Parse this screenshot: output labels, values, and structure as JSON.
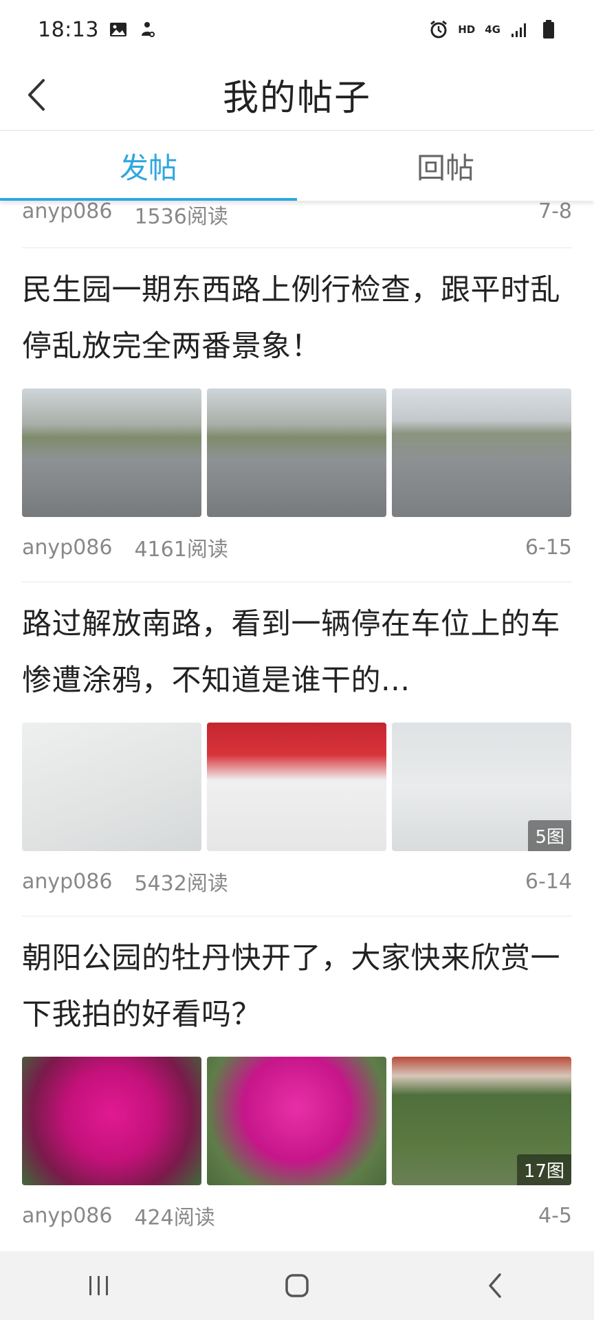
{
  "status_bar": {
    "time": "18:13",
    "left_icons": [
      "image-icon",
      "notification-icon"
    ],
    "right_icons": [
      "alarm-icon",
      "hd-icon",
      "4g-icon",
      "signal-icon",
      "battery-icon"
    ],
    "hd_label": "HD",
    "network_label": "4G"
  },
  "header": {
    "title": "我的帖子",
    "back_icon": "chevron-left-icon"
  },
  "tabs": [
    {
      "label": "发帖",
      "active": true
    },
    {
      "label": "回帖",
      "active": false
    }
  ],
  "accent_color": "#2ea7e0",
  "partial_top_post": {
    "author": "anyp086",
    "reads": "1536阅读",
    "date": "7-8"
  },
  "posts": [
    {
      "title": "民生园一期东西路上例行检查，跟平时乱停乱放完全两番景象！",
      "author": "anyp086",
      "reads": "4161阅读",
      "date": "6-15",
      "image_count": ""
    },
    {
      "title": "路过解放南路，看到一辆停在车位上的车惨遭涂鸦，不知道是谁干的...",
      "author": "anyp086",
      "reads": "5432阅读",
      "date": "6-14",
      "image_count": "5图"
    },
    {
      "title": "朝阳公园的牡丹快开了，大家快来欣赏一下我拍的好看吗？",
      "author": "anyp086",
      "reads": "424阅读",
      "date": "4-5",
      "image_count": "17图"
    }
  ],
  "nav_bar": {
    "buttons": [
      "recent-apps-icon",
      "home-icon",
      "back-icon"
    ]
  }
}
